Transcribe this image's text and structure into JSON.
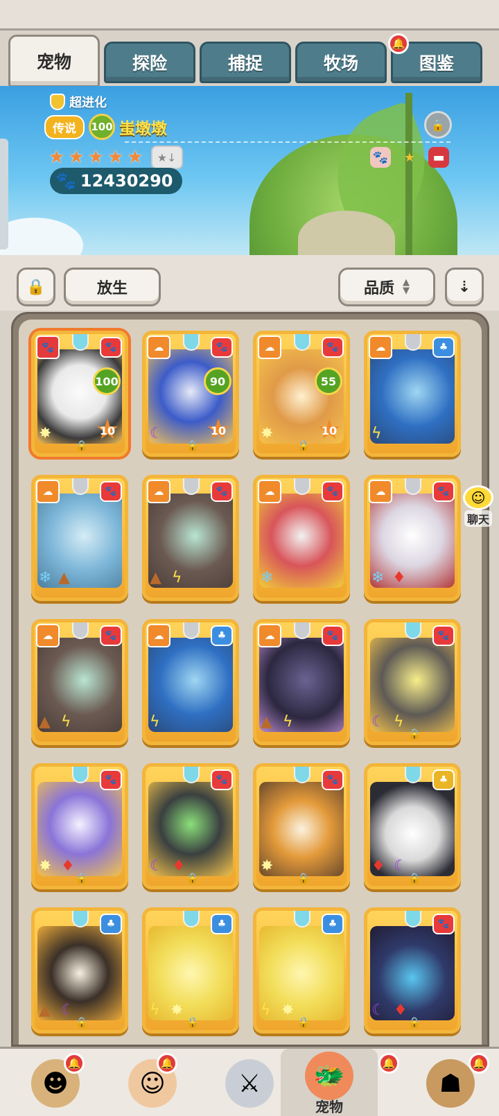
{
  "tabs": [
    {
      "label": "宠物",
      "active": true
    },
    {
      "label": "探险"
    },
    {
      "label": "捕捉"
    },
    {
      "label": "牧场",
      "notify": true
    },
    {
      "label": "图鉴"
    }
  ],
  "header": {
    "evolution": "超进化",
    "rarity": "传说",
    "level": "100",
    "name": "蚩墩墩",
    "stars": 5,
    "power": "12430290"
  },
  "toolbar": {
    "release_label": "放生",
    "sort_label": "品质"
  },
  "pets": [
    {
      "level": "100",
      "stars": "10",
      "selected": true,
      "type": "panda"
    },
    {
      "level": "90",
      "stars": "10",
      "type": "fox"
    },
    {
      "level": "55",
      "stars": "10",
      "type": "shiba"
    },
    {
      "type": "blue-dragon"
    },
    {
      "type": "ice-dragon"
    },
    {
      "type": "earth-dragon"
    },
    {
      "type": "parrot"
    },
    {
      "type": "white-dragon"
    },
    {
      "type": "earth-dragon-2"
    },
    {
      "type": "blue-dragon-2"
    },
    {
      "type": "dark-dragon"
    },
    {
      "type": "thunder-dragon"
    },
    {
      "type": "wolf"
    },
    {
      "type": "dark-wolf"
    },
    {
      "type": "hood-cat"
    },
    {
      "type": "black-white-beast"
    },
    {
      "type": "tanuki"
    },
    {
      "type": "yellow-fluff"
    },
    {
      "type": "yellow-fluff-2"
    },
    {
      "type": "armored-dragon"
    }
  ],
  "chat": {
    "label": "聊天"
  },
  "bottom_nav": [
    {
      "label": "",
      "icon": "caveman-icon"
    },
    {
      "label": "",
      "icon": "hero-icon"
    },
    {
      "label": "",
      "icon": "sword-icon"
    },
    {
      "label": "宠物",
      "icon": "pet-icon",
      "active": true
    },
    {
      "label": "",
      "icon": "totem-icon"
    }
  ]
}
